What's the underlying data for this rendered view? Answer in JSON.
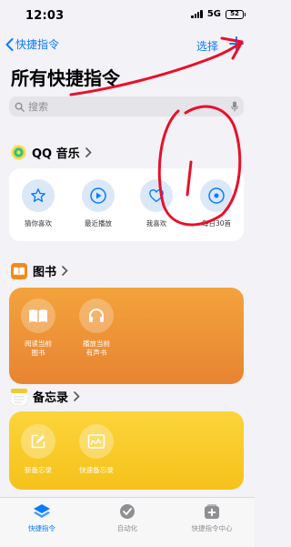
{
  "status": {
    "time": "12:03",
    "network": "5G",
    "battery": "52"
  },
  "nav": {
    "back_label": "快捷指令",
    "select_label": "选择"
  },
  "page": {
    "title": "所有快捷指令"
  },
  "search": {
    "placeholder": "搜索"
  },
  "sections": {
    "qq_music": {
      "title": "QQ 音乐",
      "items": [
        {
          "label": "猜你喜欢",
          "icon": "star-icon"
        },
        {
          "label": "最近播放",
          "icon": "play-icon"
        },
        {
          "label": "我喜欢",
          "icon": "heart-icon"
        },
        {
          "label": "每日30首",
          "icon": "music-icon"
        }
      ]
    },
    "books": {
      "title": "图书",
      "items": [
        {
          "label_line1": "阅读当前",
          "label_line2": "图书",
          "icon": "book-open-icon"
        },
        {
          "label_line1": "播放当前",
          "label_line2": "有声书",
          "icon": "headphones-icon"
        }
      ]
    },
    "notes": {
      "title": "备忘录",
      "items": [
        {
          "label": "新备忘录",
          "icon": "compose-icon"
        },
        {
          "label": "快速备忘录",
          "icon": "quick-note-icon"
        }
      ]
    }
  },
  "tabbar": {
    "tabs": [
      {
        "label": "快捷指令",
        "icon": "layers-icon",
        "active": true
      },
      {
        "label": "自动化",
        "icon": "automation-icon",
        "active": false
      },
      {
        "label": "快捷指令中心",
        "icon": "gallery-icon",
        "active": false
      }
    ]
  },
  "colors": {
    "accent": "#0a7aff",
    "books_card": "#ee9236",
    "notes_card": "#f8cc2a",
    "annotation": "#e8102a"
  }
}
